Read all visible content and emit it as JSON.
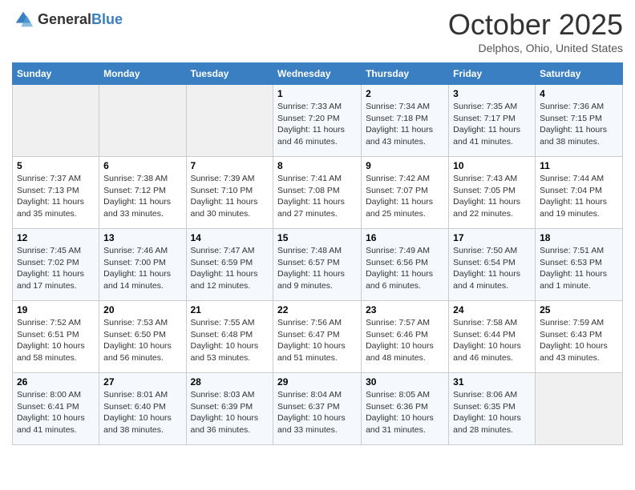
{
  "header": {
    "logo_general": "General",
    "logo_blue": "Blue",
    "month": "October 2025",
    "location": "Delphos, Ohio, United States"
  },
  "days_of_week": [
    "Sunday",
    "Monday",
    "Tuesday",
    "Wednesday",
    "Thursday",
    "Friday",
    "Saturday"
  ],
  "weeks": [
    [
      {
        "day": "",
        "info": ""
      },
      {
        "day": "",
        "info": ""
      },
      {
        "day": "",
        "info": ""
      },
      {
        "day": "1",
        "info": "Sunrise: 7:33 AM\nSunset: 7:20 PM\nDaylight: 11 hours and 46 minutes."
      },
      {
        "day": "2",
        "info": "Sunrise: 7:34 AM\nSunset: 7:18 PM\nDaylight: 11 hours and 43 minutes."
      },
      {
        "day": "3",
        "info": "Sunrise: 7:35 AM\nSunset: 7:17 PM\nDaylight: 11 hours and 41 minutes."
      },
      {
        "day": "4",
        "info": "Sunrise: 7:36 AM\nSunset: 7:15 PM\nDaylight: 11 hours and 38 minutes."
      }
    ],
    [
      {
        "day": "5",
        "info": "Sunrise: 7:37 AM\nSunset: 7:13 PM\nDaylight: 11 hours and 35 minutes."
      },
      {
        "day": "6",
        "info": "Sunrise: 7:38 AM\nSunset: 7:12 PM\nDaylight: 11 hours and 33 minutes."
      },
      {
        "day": "7",
        "info": "Sunrise: 7:39 AM\nSunset: 7:10 PM\nDaylight: 11 hours and 30 minutes."
      },
      {
        "day": "8",
        "info": "Sunrise: 7:41 AM\nSunset: 7:08 PM\nDaylight: 11 hours and 27 minutes."
      },
      {
        "day": "9",
        "info": "Sunrise: 7:42 AM\nSunset: 7:07 PM\nDaylight: 11 hours and 25 minutes."
      },
      {
        "day": "10",
        "info": "Sunrise: 7:43 AM\nSunset: 7:05 PM\nDaylight: 11 hours and 22 minutes."
      },
      {
        "day": "11",
        "info": "Sunrise: 7:44 AM\nSunset: 7:04 PM\nDaylight: 11 hours and 19 minutes."
      }
    ],
    [
      {
        "day": "12",
        "info": "Sunrise: 7:45 AM\nSunset: 7:02 PM\nDaylight: 11 hours and 17 minutes."
      },
      {
        "day": "13",
        "info": "Sunrise: 7:46 AM\nSunset: 7:00 PM\nDaylight: 11 hours and 14 minutes."
      },
      {
        "day": "14",
        "info": "Sunrise: 7:47 AM\nSunset: 6:59 PM\nDaylight: 11 hours and 12 minutes."
      },
      {
        "day": "15",
        "info": "Sunrise: 7:48 AM\nSunset: 6:57 PM\nDaylight: 11 hours and 9 minutes."
      },
      {
        "day": "16",
        "info": "Sunrise: 7:49 AM\nSunset: 6:56 PM\nDaylight: 11 hours and 6 minutes."
      },
      {
        "day": "17",
        "info": "Sunrise: 7:50 AM\nSunset: 6:54 PM\nDaylight: 11 hours and 4 minutes."
      },
      {
        "day": "18",
        "info": "Sunrise: 7:51 AM\nSunset: 6:53 PM\nDaylight: 11 hours and 1 minute."
      }
    ],
    [
      {
        "day": "19",
        "info": "Sunrise: 7:52 AM\nSunset: 6:51 PM\nDaylight: 10 hours and 58 minutes."
      },
      {
        "day": "20",
        "info": "Sunrise: 7:53 AM\nSunset: 6:50 PM\nDaylight: 10 hours and 56 minutes."
      },
      {
        "day": "21",
        "info": "Sunrise: 7:55 AM\nSunset: 6:48 PM\nDaylight: 10 hours and 53 minutes."
      },
      {
        "day": "22",
        "info": "Sunrise: 7:56 AM\nSunset: 6:47 PM\nDaylight: 10 hours and 51 minutes."
      },
      {
        "day": "23",
        "info": "Sunrise: 7:57 AM\nSunset: 6:46 PM\nDaylight: 10 hours and 48 minutes."
      },
      {
        "day": "24",
        "info": "Sunrise: 7:58 AM\nSunset: 6:44 PM\nDaylight: 10 hours and 46 minutes."
      },
      {
        "day": "25",
        "info": "Sunrise: 7:59 AM\nSunset: 6:43 PM\nDaylight: 10 hours and 43 minutes."
      }
    ],
    [
      {
        "day": "26",
        "info": "Sunrise: 8:00 AM\nSunset: 6:41 PM\nDaylight: 10 hours and 41 minutes."
      },
      {
        "day": "27",
        "info": "Sunrise: 8:01 AM\nSunset: 6:40 PM\nDaylight: 10 hours and 38 minutes."
      },
      {
        "day": "28",
        "info": "Sunrise: 8:03 AM\nSunset: 6:39 PM\nDaylight: 10 hours and 36 minutes."
      },
      {
        "day": "29",
        "info": "Sunrise: 8:04 AM\nSunset: 6:37 PM\nDaylight: 10 hours and 33 minutes."
      },
      {
        "day": "30",
        "info": "Sunrise: 8:05 AM\nSunset: 6:36 PM\nDaylight: 10 hours and 31 minutes."
      },
      {
        "day": "31",
        "info": "Sunrise: 8:06 AM\nSunset: 6:35 PM\nDaylight: 10 hours and 28 minutes."
      },
      {
        "day": "",
        "info": ""
      }
    ]
  ]
}
